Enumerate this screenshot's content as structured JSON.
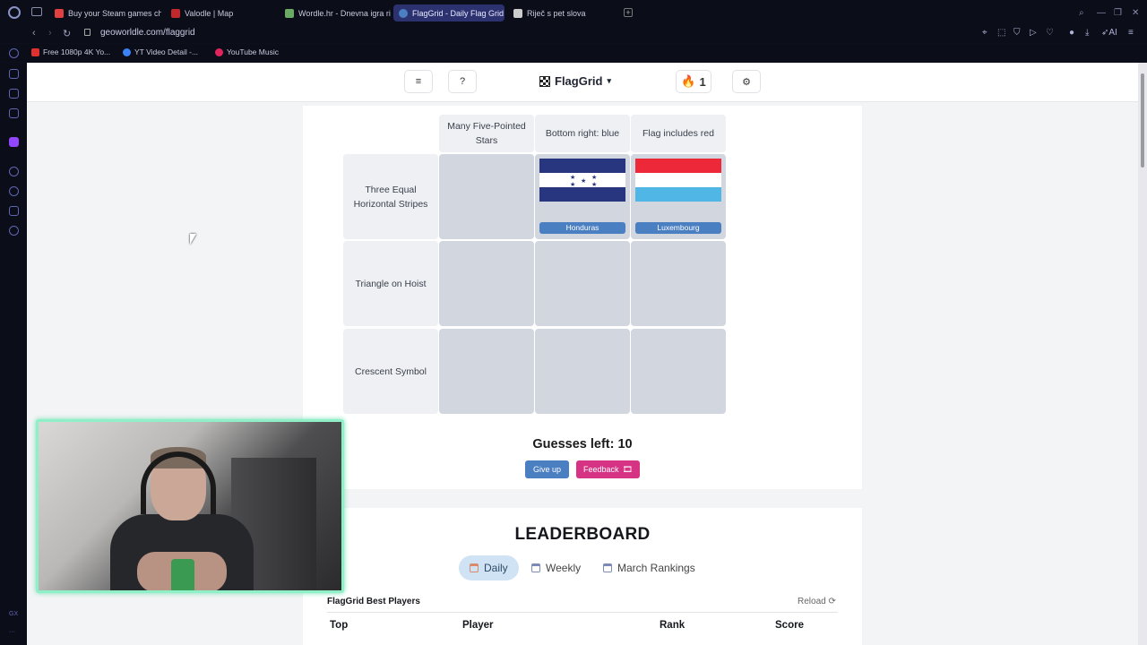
{
  "browser": {
    "tabs": [
      {
        "title": "Buy your Steam games che",
        "color": "#e04040"
      },
      {
        "title": "Valodle | Map",
        "color": "#c0282c"
      },
      {
        "title": "Wordle.hr - Dnevna igra ri",
        "color": "#6aaa64"
      },
      {
        "title": "FlagGrid - Daily Flag Grid",
        "color": "#4a7fc1"
      },
      {
        "title": "Riječ s pet slova",
        "color": "#cccccc"
      }
    ],
    "url": "geoworldle.com/flaggrid",
    "bookmarks": [
      {
        "label": "Free 1080p 4K Yo...",
        "color": "#e03030"
      },
      {
        "label": "YT Video Detail -...",
        "color": "#3b82f6"
      },
      {
        "label": "YouTube Music",
        "color": "#e0245e"
      }
    ],
    "right_icons": [
      "pin-icon",
      "crop-icon",
      "shield-icon",
      "play-icon",
      "heart-icon",
      "profile-icon",
      "download-icon",
      "ai-icon",
      "menu-icon"
    ],
    "ai_label": "AI",
    "sidebar_footer": "GX"
  },
  "nav": {
    "menu_label": "≡",
    "help_label": "?",
    "brand": "FlagGrid",
    "brand_caret": "▾",
    "streak_icon": "🔥",
    "streak": "1",
    "settings_icon": "⚙"
  },
  "grid": {
    "columns": [
      "Many Five-Pointed Stars",
      "Bottom right: blue",
      "Flag includes red"
    ],
    "rows": [
      "Three Equal Horizontal Stripes",
      "Triangle on Hoist",
      "Crescent Symbol"
    ],
    "answers": [
      {
        "row": 0,
        "col": 1,
        "country": "Honduras"
      },
      {
        "row": 0,
        "col": 2,
        "country": "Luxembourg"
      }
    ]
  },
  "status": {
    "guesses_label": "Guesses left: 10",
    "give_up": "Give up",
    "feedback": "Feedback",
    "feedback_icon": "🎞"
  },
  "leaderboard": {
    "title": "LEADERBOARD",
    "tabs": [
      "Daily",
      "Weekly",
      "March Rankings"
    ],
    "active_tab": "Daily",
    "section": "FlagGrid Best Players",
    "reload": "Reload ⟳",
    "headers": [
      "Top",
      "Player",
      "Rank",
      "Score"
    ]
  },
  "colors": {
    "accent": "#4a7fc1",
    "feedback": "#d63384",
    "cell_empty": "#d1d6df",
    "header_bg": "#eef0f4",
    "honduras_blue": "#28357f",
    "luxembourg_red": "#ed2939",
    "luxembourg_blue": "#4fb6e6"
  }
}
